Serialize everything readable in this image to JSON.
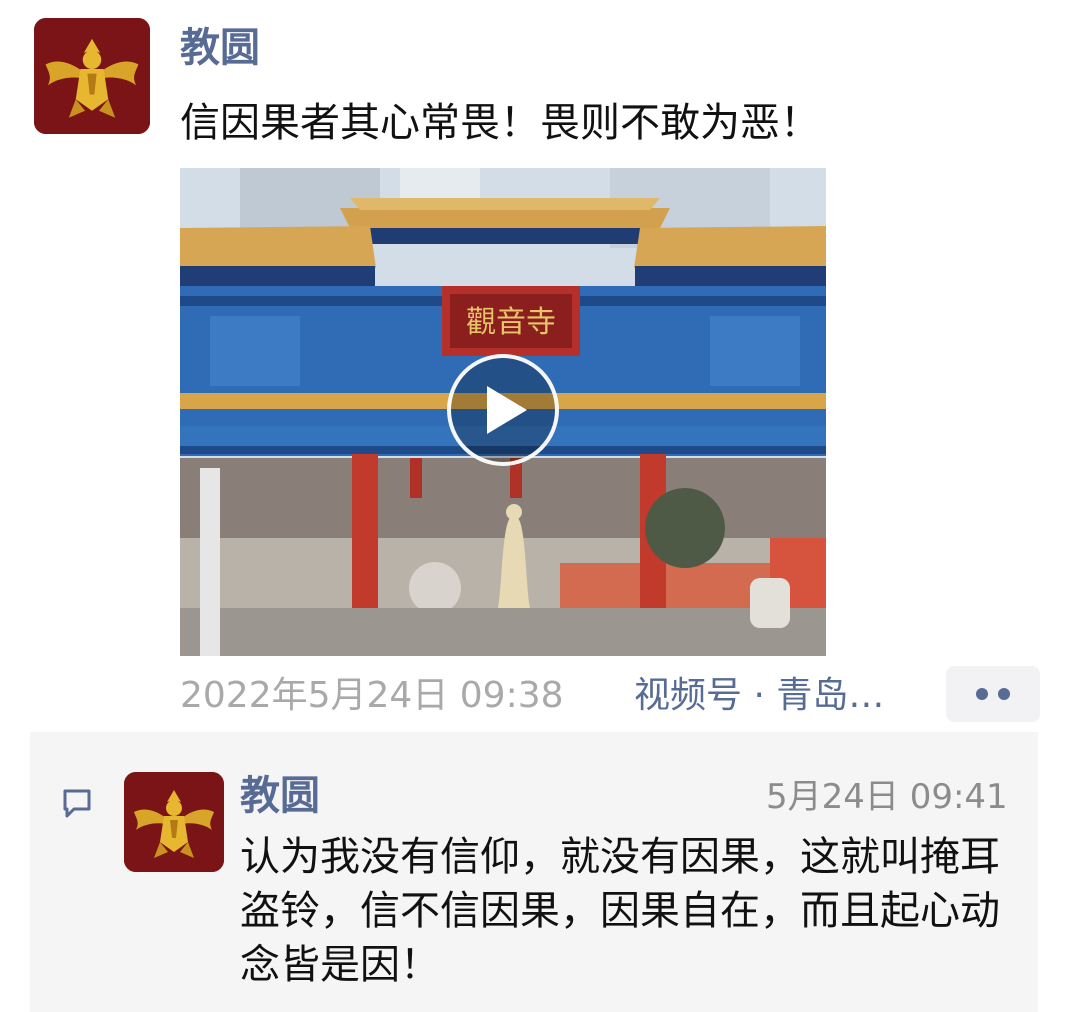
{
  "post": {
    "author": "教圆",
    "text": "信因果者其心常畏！畏则不敢为恶！",
    "video": {
      "plaque_text": "觀音寺",
      "play_icon": "play-icon"
    },
    "timestamp": "2022年5月24日 09:38",
    "source": "视频号 · 青岛…",
    "more_icon": "more-dots-icon"
  },
  "comment": {
    "icon": "comment-bubble-icon",
    "author": "教圆",
    "time": "5月24日 09:41",
    "text": "认为我没有信仰，就没有因果，这就叫掩耳盗铃，信不信因果，因果自在，而且起心动念皆是因！"
  },
  "colors": {
    "link": "#576b95",
    "avatar_bg": "#7a1417",
    "avatar_emblem": "#d9a528",
    "comment_bg": "#f5f5f5",
    "timestamp": "#a9a9a9"
  }
}
